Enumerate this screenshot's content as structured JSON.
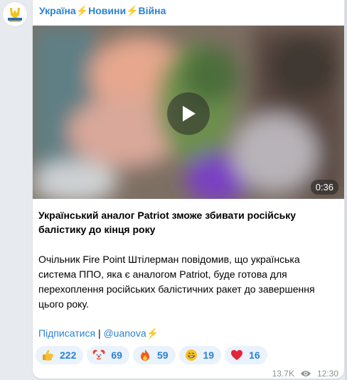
{
  "channel": {
    "name_parts": [
      "Україна",
      "Новини",
      "Війна"
    ],
    "bolt": "⚡",
    "avatar_icon": "channel-logo-icon"
  },
  "video": {
    "duration": "0:36",
    "play_icon": "play-icon"
  },
  "post": {
    "headline": "Український аналог Patriot зможе збивати російську балістику до кінця року",
    "body": "Очільник Fire Point Штілерман повідомив, що українська система ППО, яка є аналогом Patriot, буде готова для перехоплення російських балістичних ракет до завершення цього року.",
    "subscribe_label": "Підписатися",
    "separator": "|",
    "handle": "@uanova",
    "handle_bolt": "⚡"
  },
  "reactions": [
    {
      "emoji": "thumbs-up-icon",
      "count": "222"
    },
    {
      "emoji": "clown-face-icon",
      "count": "69"
    },
    {
      "emoji": "fire-icon",
      "count": "59"
    },
    {
      "emoji": "grin-icon",
      "count": "19"
    },
    {
      "emoji": "heart-icon",
      "count": "16"
    }
  ],
  "meta": {
    "views": "13.7K",
    "time": "12:30",
    "views_icon": "eye-icon"
  },
  "colors": {
    "link": "#2b82d1",
    "reaction_bg": "#eaf2fb",
    "bolt": "#f2b91d",
    "background": "#e7ebf0"
  }
}
